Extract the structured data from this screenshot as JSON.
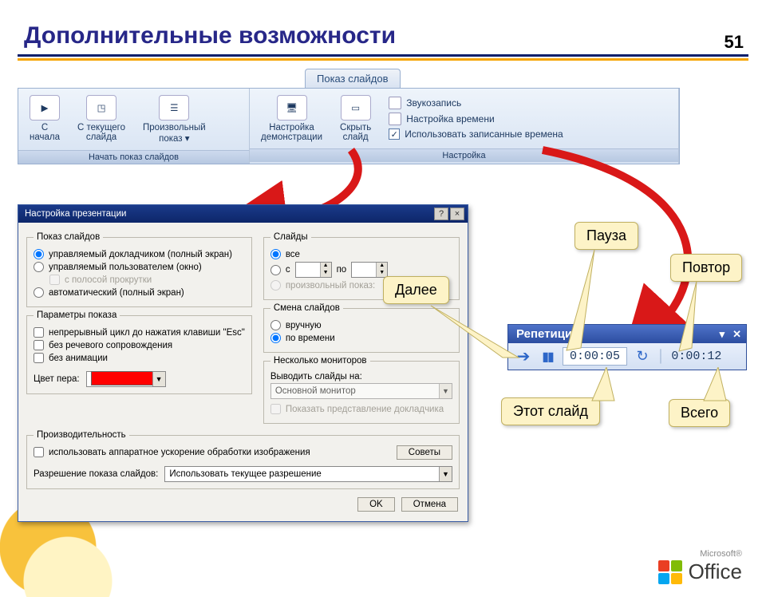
{
  "page_number": "51",
  "title": "Дополнительные возможности",
  "ribbon": {
    "tab": "Показ слайдов",
    "group1_title": "Начать показ слайдов",
    "btn_from_start": "С\nначала",
    "btn_from_current": "С текущего\nслайда",
    "btn_custom": "Произвольный\nпоказ ▾",
    "group2_title": "Настройка",
    "btn_setup": "Настройка\nдемонстрации",
    "btn_hide": "Скрыть\nслайд",
    "opt_record": "Звукозапись",
    "opt_rehearse": "Настройка времени",
    "opt_use_timings": "Использовать записанные времена"
  },
  "dialog": {
    "title": "Настройка презентации",
    "close": "×",
    "help": "?",
    "grp_show": "Показ слайдов",
    "r_presenter": "управляемый докладчиком (полный экран)",
    "r_browsed": "управляемый пользователем (окно)",
    "chk_scrollbar": "с полосой прокрутки",
    "r_kiosk": "автоматический (полный экран)",
    "grp_options": "Параметры показа",
    "chk_loop": "непрерывный цикл до нажатия клавиши \"Esc\"",
    "chk_no_narration": "без речевого сопровождения",
    "chk_no_anim": "без анимации",
    "lbl_pen": "Цвет пера:",
    "grp_slides": "Слайды",
    "r_all": "все",
    "r_from": "с",
    "lbl_to": "по",
    "r_custom_show": "произвольный показ:",
    "grp_advance": "Смена слайдов",
    "r_manual": "вручную",
    "r_timing": "по времени",
    "grp_monitors": "Несколько мониторов",
    "lbl_display_on": "Выводить слайды на:",
    "val_primary_monitor": "Основной монитор",
    "chk_presenter_view": "Показать представление докладчика",
    "grp_perf": "Производительность",
    "chk_hw": "использовать аппаратное ускорение обработки изображения",
    "btn_tips": "Советы",
    "lbl_resolution": "Разрешение показа слайдов:",
    "val_resolution": "Использовать текущее разрешение",
    "btn_ok": "OK",
    "btn_cancel": "Отмена"
  },
  "rehearsal": {
    "title": "Репетиция",
    "slide_time": "0:00:05",
    "total_time": "0:00:12"
  },
  "callouts": {
    "next": "Далее",
    "pause": "Пауза",
    "repeat": "Повтор",
    "this_slide": "Этот слайд",
    "total": "Всего"
  },
  "brand": "Office",
  "ms": "Microsoft®"
}
